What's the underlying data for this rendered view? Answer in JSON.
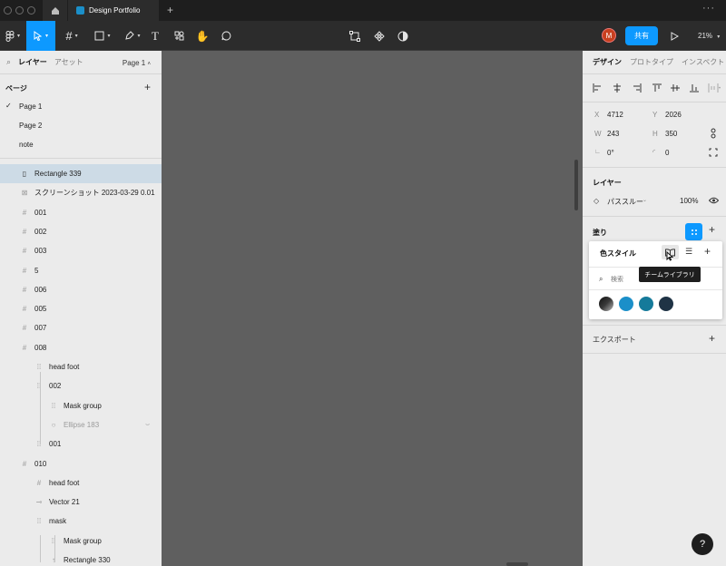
{
  "titlebar": {
    "doc_tab_label": "Design Portfolio",
    "new_tab_icon": "+",
    "more_icon": "···"
  },
  "toolbar": {
    "avatar_initial": "M",
    "share_label": "共有",
    "zoom_label": "21%"
  },
  "left_panel": {
    "tabs": {
      "layers": "レイヤー",
      "assets": "アセット"
    },
    "page_selector": "Page 1",
    "pages_header": "ページ",
    "add_icon": "+",
    "pages": [
      {
        "label": "Page 1",
        "checked": true
      },
      {
        "label": "Page 2",
        "checked": false
      },
      {
        "label": "note",
        "checked": false
      }
    ],
    "layers": [
      {
        "label": "Rectangle 339",
        "icon": "rectangle-icon",
        "indent": 0,
        "selected": true
      },
      {
        "label": "スクリーンショット 2023-03-29 0.01",
        "icon": "image-icon",
        "indent": 0
      },
      {
        "label": "001",
        "icon": "frame-icon",
        "indent": 0
      },
      {
        "label": "002",
        "icon": "frame-icon",
        "indent": 0
      },
      {
        "label": "003",
        "icon": "frame-icon",
        "indent": 0
      },
      {
        "label": "5",
        "icon": "frame-icon",
        "indent": 0
      },
      {
        "label": "006",
        "icon": "frame-icon",
        "indent": 0
      },
      {
        "label": "005",
        "icon": "frame-icon",
        "indent": 0
      },
      {
        "label": "007",
        "icon": "frame-icon",
        "indent": 0
      },
      {
        "label": "008",
        "icon": "frame-icon",
        "indent": 0
      },
      {
        "label": "head foot",
        "icon": "group-icon",
        "indent": 1
      },
      {
        "label": "002",
        "icon": "group-icon",
        "indent": 1
      },
      {
        "label": "Mask group",
        "icon": "group-icon",
        "indent": 2
      },
      {
        "label": "Ellipse 183",
        "icon": "ellipse-icon",
        "indent": 2,
        "dim": true
      },
      {
        "label": "001",
        "icon": "group-icon",
        "indent": 1
      },
      {
        "label": "010",
        "icon": "frame-icon",
        "indent": 0
      },
      {
        "label": "head foot",
        "icon": "frame-icon",
        "indent": 1
      },
      {
        "label": "Vector 21",
        "icon": "vector-icon",
        "indent": 1
      },
      {
        "label": "mask",
        "icon": "group-icon",
        "indent": 1
      },
      {
        "label": "Mask group",
        "icon": "group-icon",
        "indent": 2
      },
      {
        "label": "Rectangle 330",
        "icon": "arrow-icon",
        "indent": 2
      }
    ]
  },
  "right_panel": {
    "tabs": {
      "design": "デザイン",
      "prototype": "プロトタイプ",
      "inspect": "インスペクト"
    },
    "props": {
      "x_label": "X",
      "x_value": "4712",
      "y_label": "Y",
      "y_value": "2026",
      "w_label": "W",
      "w_value": "243",
      "h_label": "H",
      "h_value": "350",
      "rotation_value": "0°",
      "radius_value": "0"
    },
    "layer_section": {
      "title": "レイヤー",
      "blend": "パススルー",
      "opacity": "100%"
    },
    "fill_section": {
      "title": "塗り"
    },
    "export_section": {
      "title": "エクスポート"
    }
  },
  "color_popover": {
    "title": "色スタイル",
    "search_placeholder": "検索",
    "add_icon": "+",
    "tooltip": "チームライブラリ",
    "swatches": [
      "#3a3a3a",
      "#1b8fc9",
      "#157a9a",
      "#1f3345"
    ]
  },
  "help": {
    "label": "?"
  }
}
